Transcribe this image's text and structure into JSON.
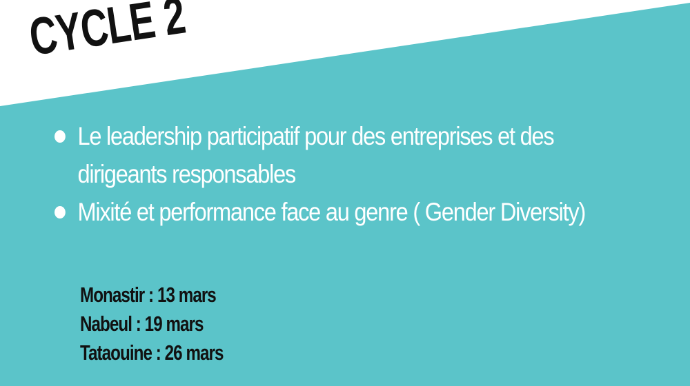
{
  "title": "CYCLE 2",
  "bullets": [
    {
      "text": "Le leadership participatif pour des entreprises et des dirigeants responsables"
    },
    {
      "text": "Mixité et performance face au genre ( Gender Diversity)"
    }
  ],
  "dates": [
    "Monastir : 13 mars",
    "Nabeul : 19 mars",
    "Tataouine : 26 mars"
  ],
  "colors": {
    "background": "#5bc4c9",
    "band": "#ffffff",
    "title": "#111111",
    "bullet_text": "#ffffff",
    "dates": "#111111"
  }
}
